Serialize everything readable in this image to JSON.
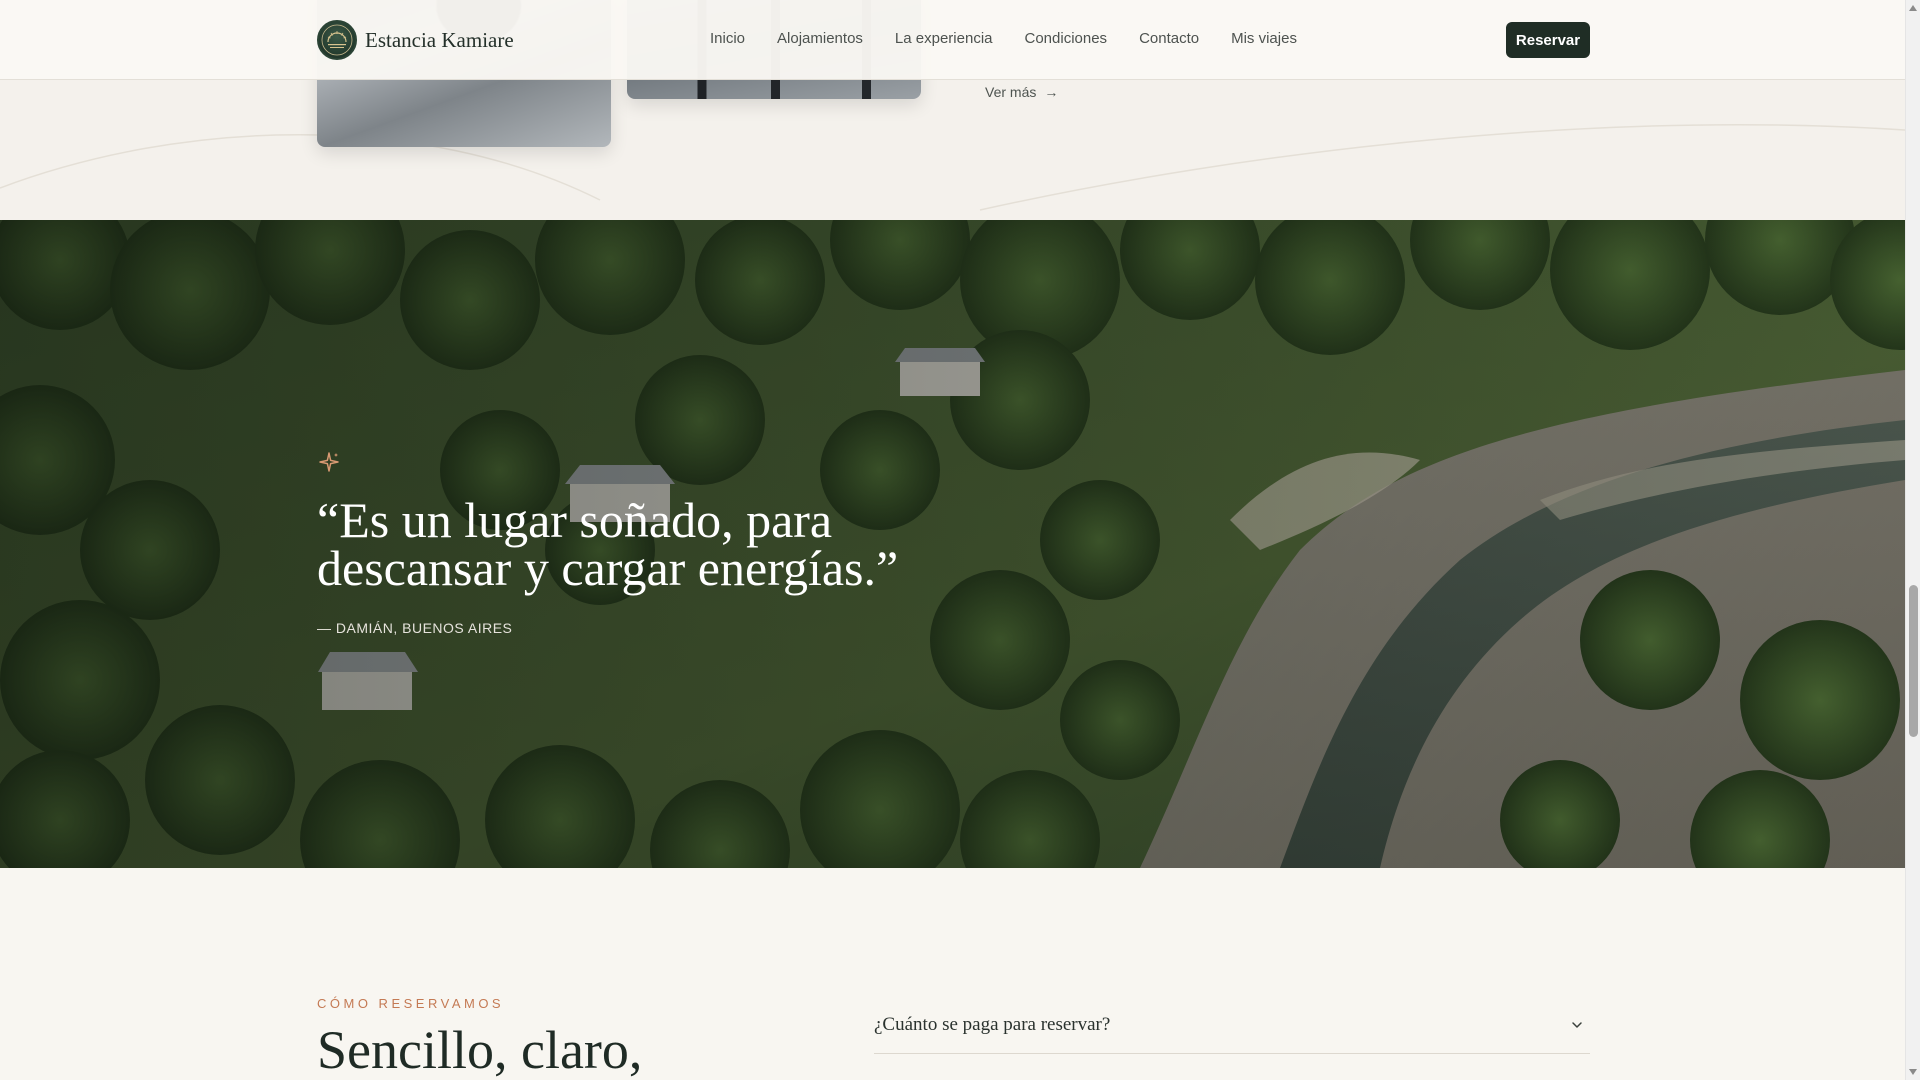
{
  "header": {
    "brand_name": "Estancia Kamiare",
    "logo_icon": "estancia-kamiare-logo",
    "nav": [
      {
        "label": "Inicio"
      },
      {
        "label": "Alojamientos"
      },
      {
        "label": "La experiencia"
      },
      {
        "label": "Condiciones"
      },
      {
        "label": "Contacto"
      },
      {
        "label": "Mis viajes"
      }
    ],
    "cta_label": "Reservar"
  },
  "gallery": {
    "link_label": "Ver más",
    "link_icon": "arrow-right-icon"
  },
  "testimonial": {
    "icon": "sparkle-icon",
    "quote": "“Es un lugar soñado, para descansar y cargar energías.”",
    "author": "— DAMIÁN, BUENOS AIRES"
  },
  "booking": {
    "eyebrow": "CÓMO RESERVAMOS",
    "title": "Sencillo, claro,",
    "faq": [
      {
        "question": "¿Cuánto se paga para reservar?",
        "icon": "chevron-down-icon"
      }
    ]
  },
  "colors": {
    "primary_dark": "#1f2d25",
    "accent": "#c47a54",
    "background": "#f6f3ee"
  }
}
